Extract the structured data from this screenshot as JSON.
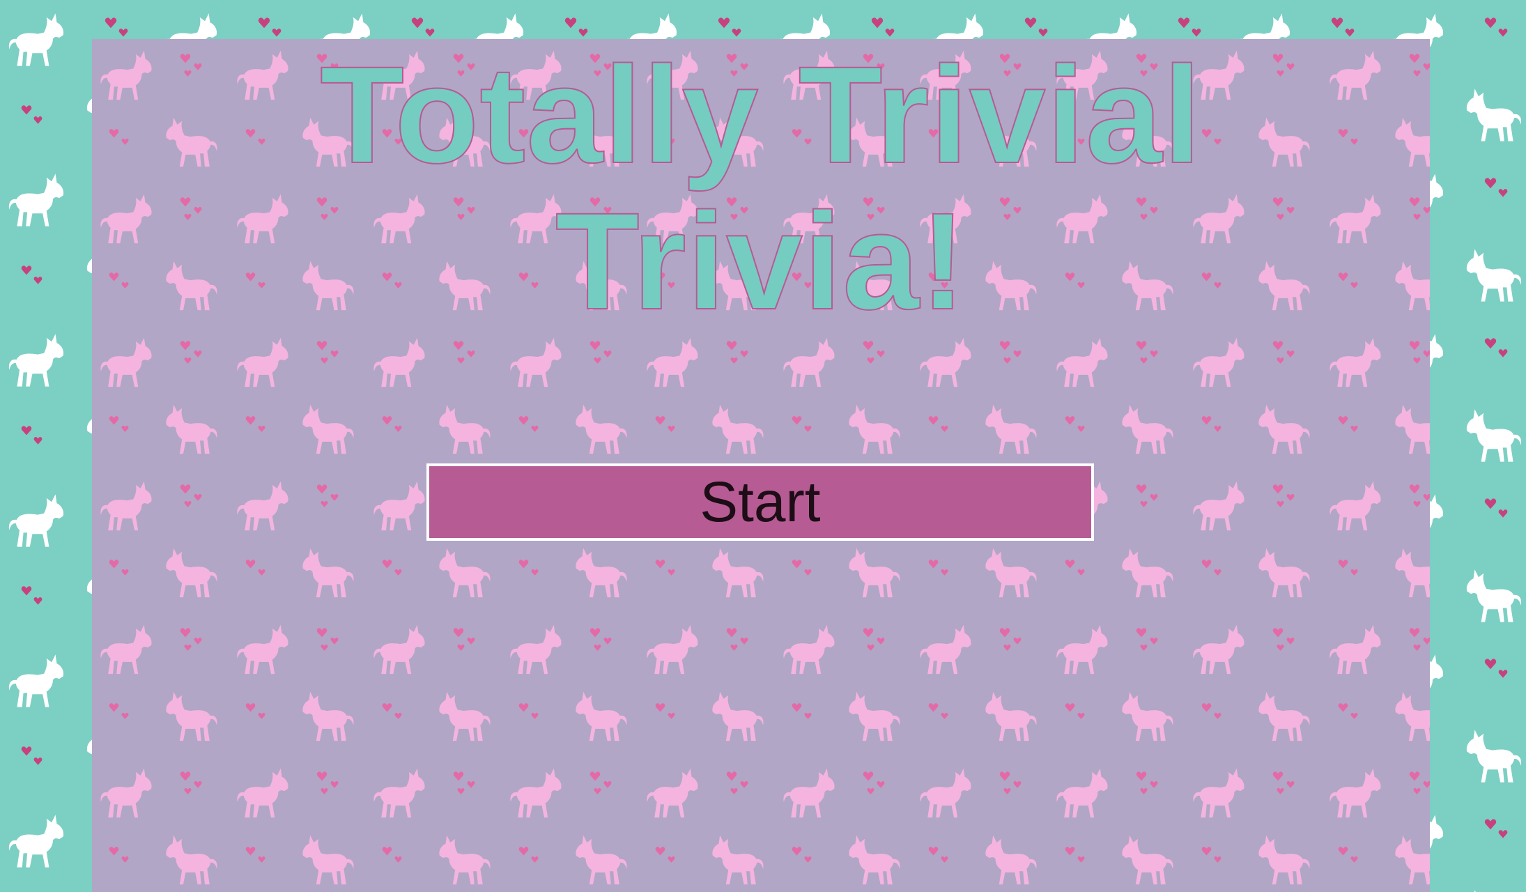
{
  "app": {
    "title_line_1": "Totally Trivial",
    "title_line_2": "Trivia!"
  },
  "start_button": {
    "label": "Start"
  },
  "colors": {
    "outer_background": "#7ccfc3",
    "outer_unicorn": "#ffffff",
    "outer_heart": "#c8417f",
    "panel_background": "#b1a6c6",
    "panel_unicorn": "#f4b4df",
    "panel_heart": "#e46aa7",
    "title_fill": "#74cdc0",
    "title_outline": "#b65a95",
    "button_background": "#b75b94",
    "button_border": "#ffffff",
    "button_text": "#1c0d16"
  },
  "icons": {
    "background_motif": "unicorn-icon",
    "background_accent": "heart-icon"
  }
}
